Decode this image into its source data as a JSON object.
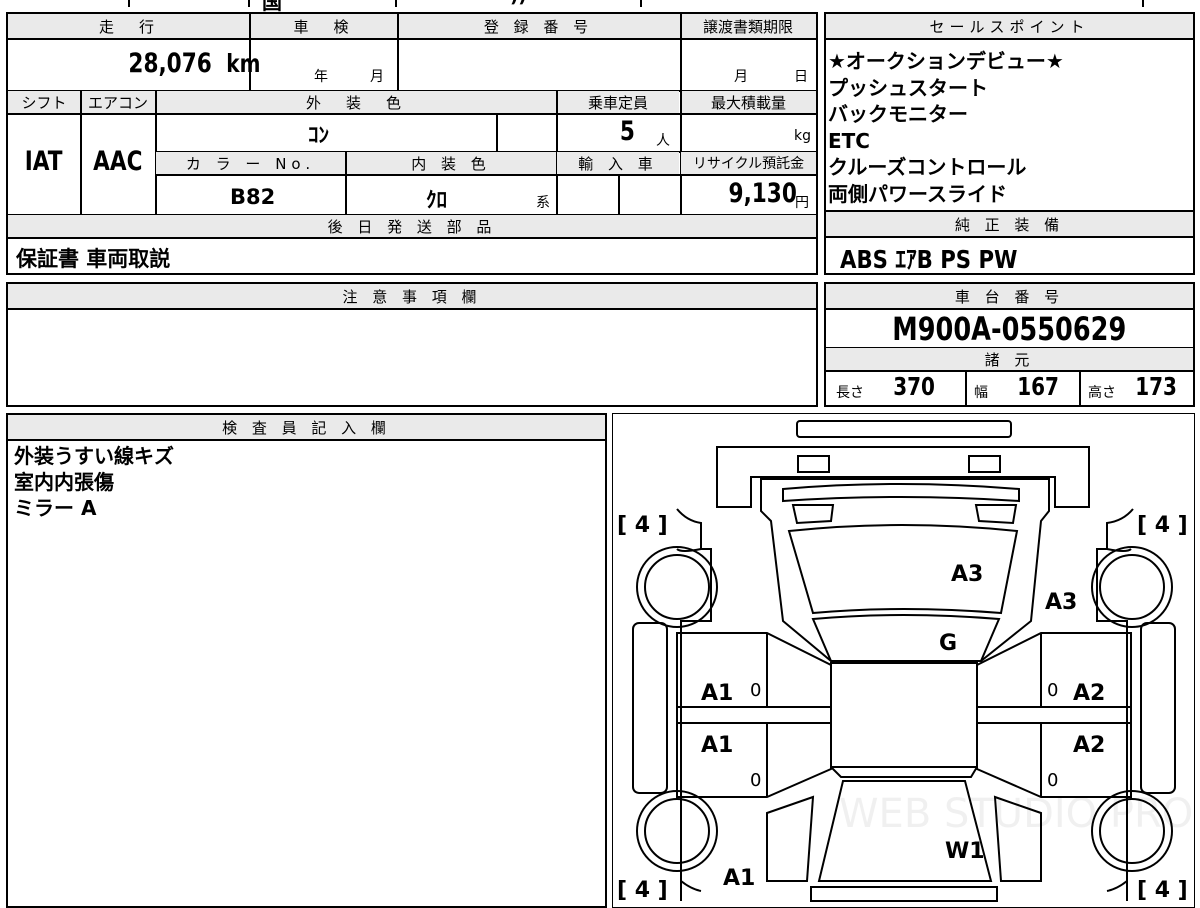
{
  "top_strip": {
    "frag_a": "国",
    "frag_b": "))"
  },
  "headers": {
    "mileage": "走　行",
    "shaken": "車　検",
    "registration": "登 録 番 号",
    "transfer_deadline": "譲渡書類期限",
    "sales_points": "セールスポイント",
    "shift": "シフト",
    "aircon": "エアコン",
    "exterior_color": "外　装　色",
    "capacity": "乗車定員",
    "max_load": "最大積載量",
    "color_no": "カ ラ ー No.",
    "interior_color": "内 装 色",
    "import": "輸 入 車",
    "recycle": "リサイクル預託金",
    "later_parts": "後 日 発 送 部 品",
    "standard_equipment": "純 正 装 備",
    "notes": "注 意 事 項 欄",
    "chassis_no": "車 台 番 号",
    "specs": "諸 元",
    "inspector": "検 査 員 記 入 欄"
  },
  "mileage": {
    "value": "28,076",
    "unit": "km"
  },
  "shaken": {
    "year_unit": "年",
    "month_unit": "月"
  },
  "transfer": {
    "month_unit": "月",
    "day_unit": "日"
  },
  "shift": "IAT",
  "aircon": "AAC",
  "exterior_color": "ｺﾝ",
  "capacity": {
    "value": "5",
    "unit": "人"
  },
  "max_load": {
    "unit": "kg"
  },
  "color_no": "B82",
  "interior_color": {
    "value": "ｸﾛ",
    "suffix": "系"
  },
  "recycle": {
    "value": "9,130",
    "unit": "円"
  },
  "later_parts": "保証書 車両取説",
  "sales_points": [
    "★オークションデビュー★",
    "プッシュスタート",
    "バックモニター",
    "ETC",
    "クルーズコントロール",
    "両側パワースライド"
  ],
  "standard_equipment": "ABS ｴｱB PS PW",
  "chassis_no": "M900A-0550629",
  "specs": [
    {
      "label": "長さ",
      "value": "370"
    },
    {
      "label": "幅",
      "value": "167"
    },
    {
      "label": "高さ",
      "value": "173"
    }
  ],
  "inspector_notes": [
    "外装うすい線キズ",
    "室内内張傷",
    "ミラー A"
  ],
  "diagram": {
    "tire_labels": [
      "[ 4 ]",
      "[ 4 ]",
      "[ 4 ]",
      "[ 4 ]"
    ],
    "marks": [
      "A3",
      "A3",
      "G",
      "A1",
      "A2",
      "A1",
      "A2",
      "W1",
      "A1"
    ],
    "zero_marks": [
      "0",
      "0",
      "0",
      "0"
    ],
    "watermark": "WEB STUDIO PRO"
  }
}
